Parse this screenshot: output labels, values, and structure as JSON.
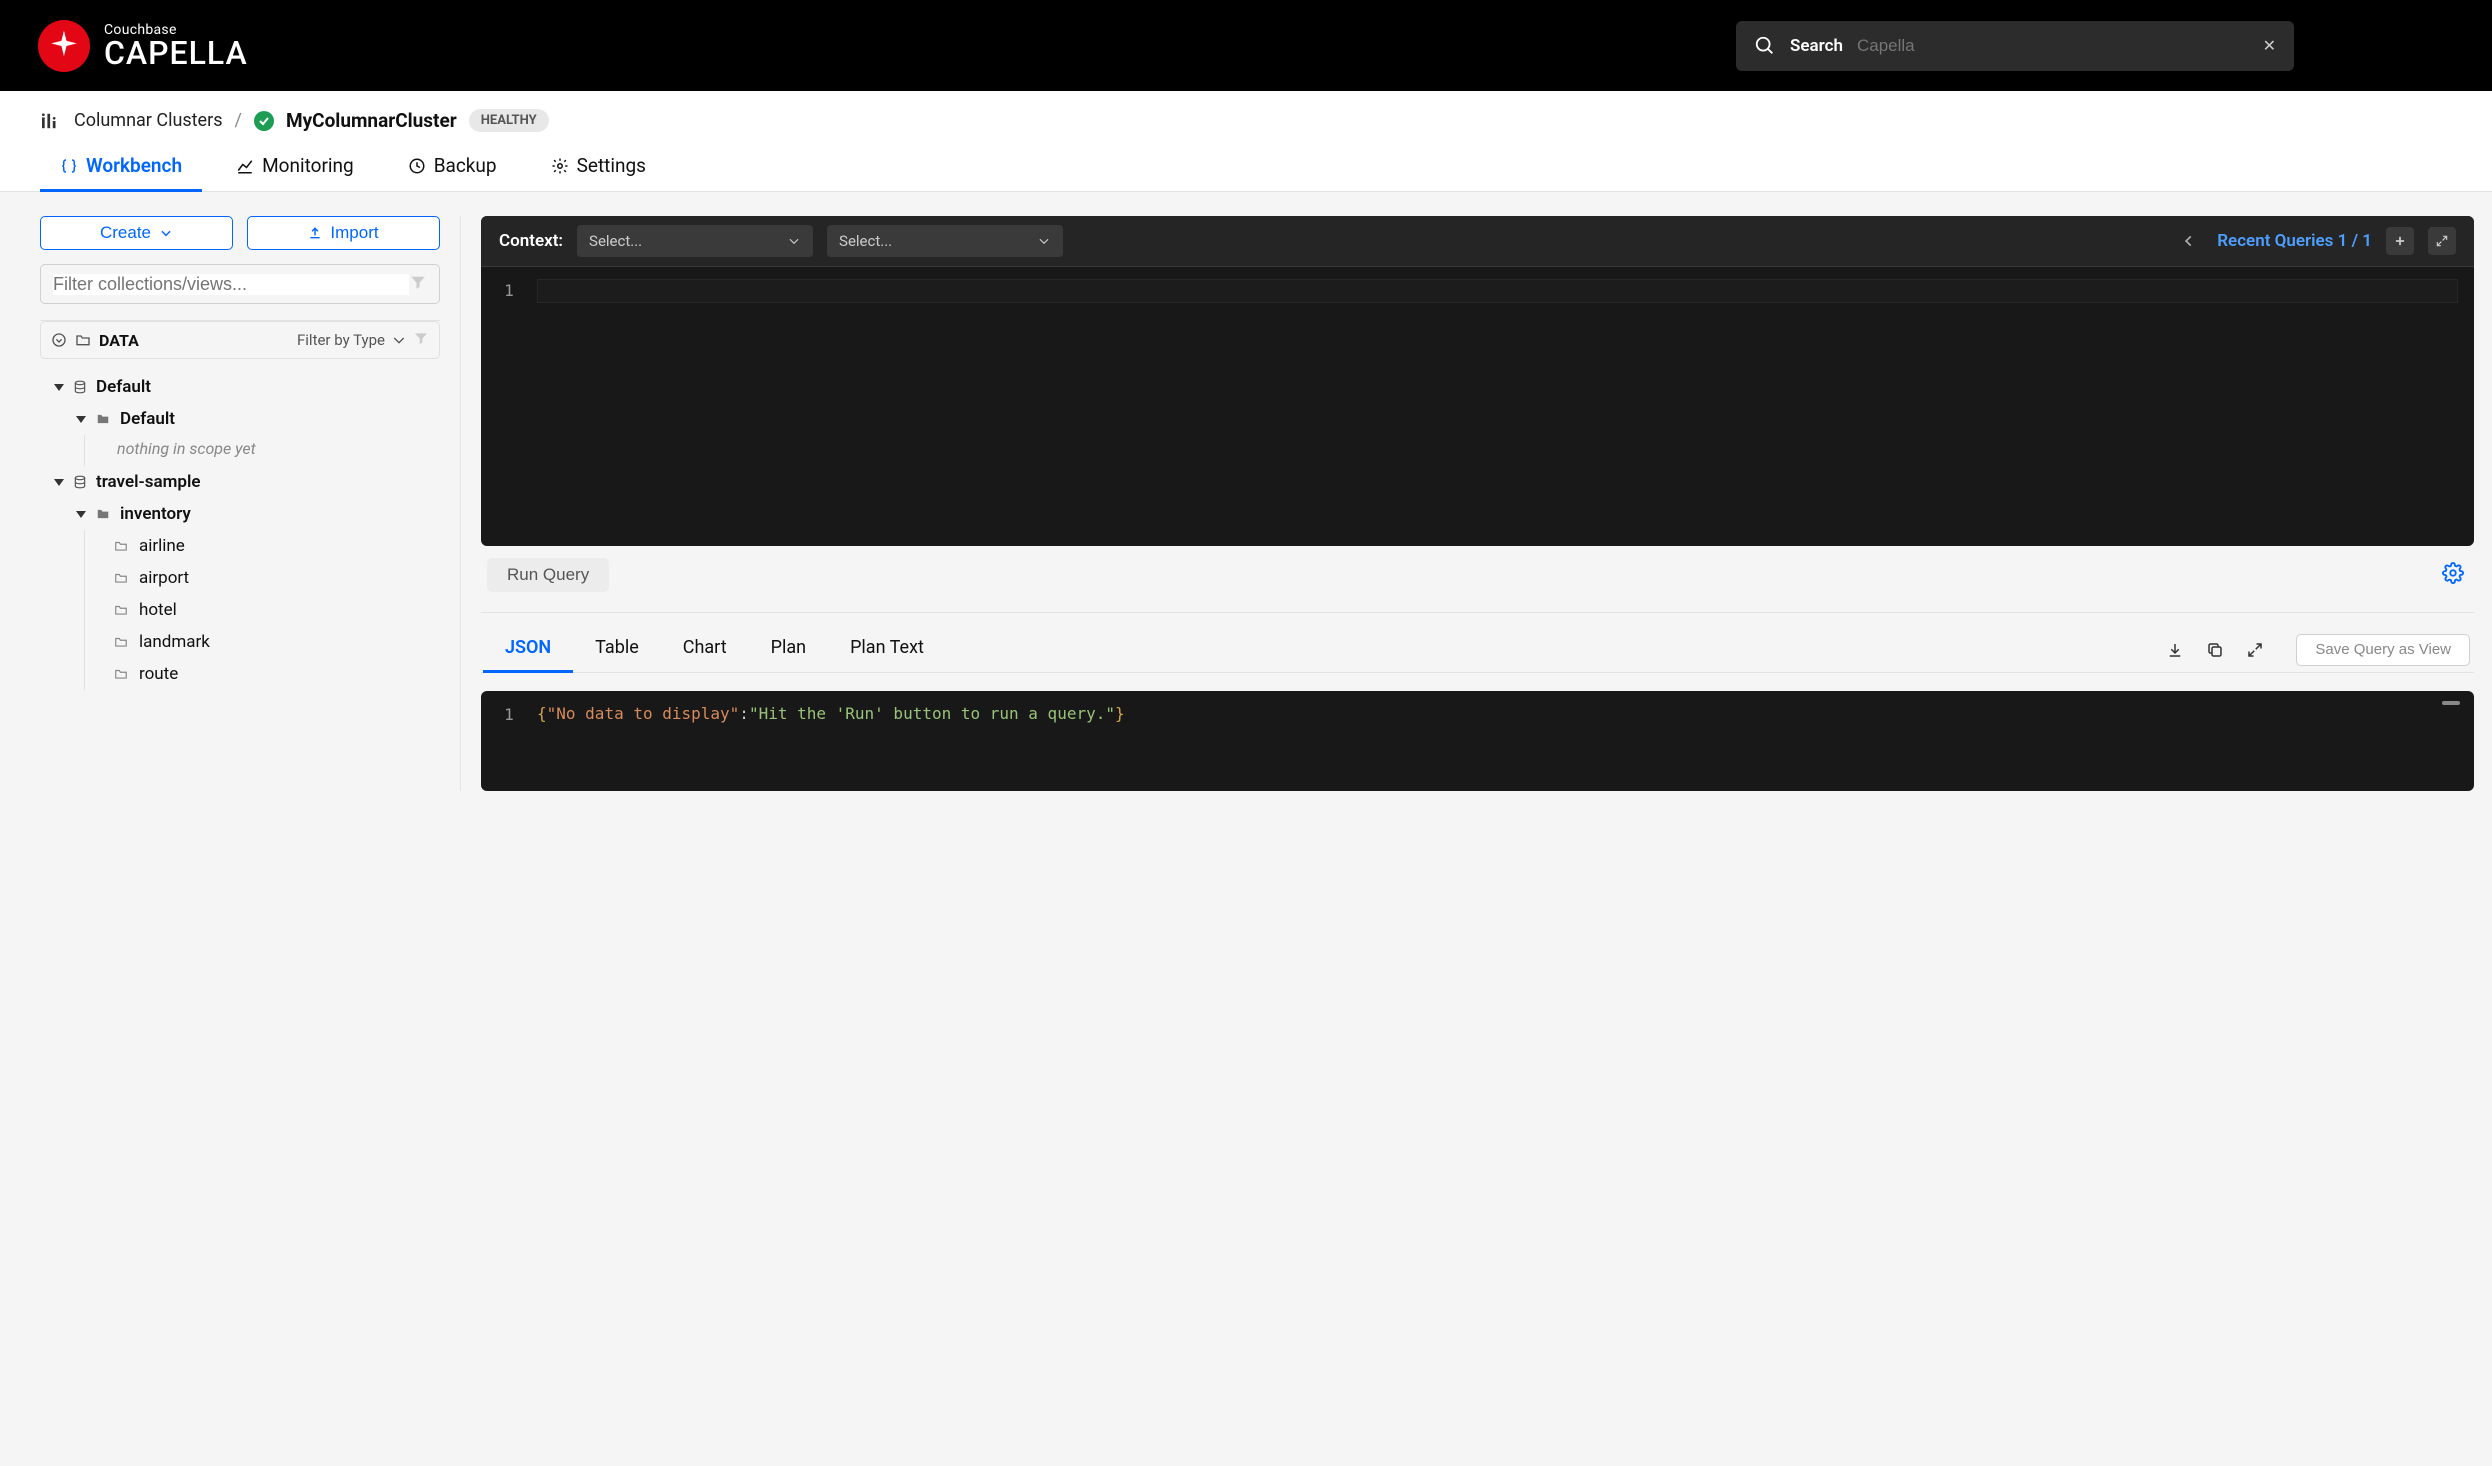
{
  "brand": {
    "sub": "Couchbase",
    "main": "CAPELLA"
  },
  "search": {
    "label": "Search",
    "placeholder": "Capella"
  },
  "breadcrumb": {
    "root": "Columnar Clusters",
    "cluster": "MyColumnarCluster",
    "badge": "HEALTHY"
  },
  "tabs": [
    {
      "label": "Workbench",
      "active": true
    },
    {
      "label": "Monitoring"
    },
    {
      "label": "Backup"
    },
    {
      "label": "Settings"
    }
  ],
  "sidebar": {
    "create": "Create",
    "import": "Import",
    "filter_placeholder": "Filter collections/views...",
    "data_label": "DATA",
    "filter_type": "Filter by Type",
    "empty_scope": "nothing in scope yet",
    "buckets": [
      {
        "name": "Default",
        "scopes": [
          {
            "name": "Default",
            "collections": []
          }
        ]
      },
      {
        "name": "travel-sample",
        "scopes": [
          {
            "name": "inventory",
            "collections": [
              "airline",
              "airport",
              "hotel",
              "landmark",
              "route"
            ]
          }
        ]
      }
    ]
  },
  "editor": {
    "context_label": "Context:",
    "select_placeholder": "Select...",
    "recent": "Recent Queries 1 / 1",
    "line_no": "1",
    "run": "Run Query"
  },
  "results": {
    "tabs": [
      "JSON",
      "Table",
      "Chart",
      "Plan",
      "Plan Text"
    ],
    "save_view": "Save Query as View",
    "line_no": "1",
    "json": {
      "key": "\"No data to display\"",
      "value": "\"Hit the 'Run' button to run a query.\""
    }
  }
}
